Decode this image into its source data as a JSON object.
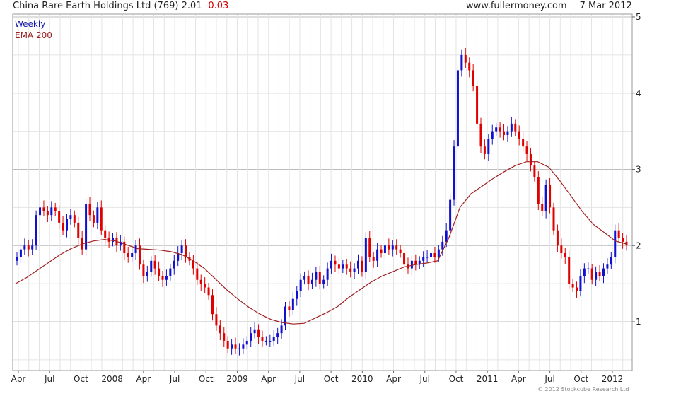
{
  "header": {
    "title": "China Rare Earth Holdings Ltd (769)",
    "price": "2.01",
    "change": "-0.03",
    "source": "www.fullermoney.com",
    "date": "7 Mar 2012"
  },
  "legend": {
    "weekly": "Weekly",
    "ema": "EMA 200"
  },
  "copyright": "© 2012 Stockcube Research Ltd",
  "colors": {
    "up": "#1010d0",
    "down": "#e00000",
    "ema": "#a02020",
    "grid": "#d8d8d8"
  },
  "chart_data": {
    "type": "line",
    "title": "China Rare Earth Holdings Ltd (769)",
    "xlabel": "",
    "ylabel": "",
    "ylim": [
      0.35,
      5.05
    ],
    "y_ticks": [
      1,
      2,
      3,
      4,
      5
    ],
    "x_tick_labels": [
      "Apr",
      "Jul",
      "Oct",
      "2008",
      "Apr",
      "Jul",
      "Oct",
      "2009",
      "Apr",
      "Jul",
      "Oct",
      "2010",
      "Apr",
      "Jul",
      "Oct",
      "2011",
      "Apr",
      "Jul",
      "Oct",
      "2012"
    ],
    "grid": true,
    "series": [
      {
        "name": "Weekly",
        "style": "candlestick",
        "values": [
          1.85,
          1.95,
          2.0,
          1.95,
          2.0,
          2.4,
          2.5,
          2.45,
          2.4,
          2.5,
          2.45,
          2.3,
          2.2,
          2.35,
          2.4,
          2.3,
          2.1,
          1.95,
          2.55,
          2.4,
          2.3,
          2.5,
          2.2,
          2.1,
          2.05,
          2.1,
          2.0,
          2.05,
          1.9,
          1.85,
          1.9,
          2.0,
          1.75,
          1.6,
          1.65,
          1.8,
          1.7,
          1.6,
          1.55,
          1.6,
          1.7,
          1.8,
          1.9,
          2.0,
          1.85,
          1.8,
          1.7,
          1.55,
          1.5,
          1.45,
          1.35,
          1.1,
          0.95,
          0.85,
          0.75,
          0.65,
          0.7,
          0.65,
          0.65,
          0.7,
          0.75,
          0.85,
          0.9,
          0.8,
          0.75,
          0.75,
          0.75,
          0.8,
          0.85,
          0.95,
          1.2,
          1.15,
          1.3,
          1.4,
          1.55,
          1.6,
          1.5,
          1.55,
          1.65,
          1.5,
          1.55,
          1.7,
          1.8,
          1.75,
          1.7,
          1.75,
          1.7,
          1.65,
          1.7,
          1.8,
          1.65,
          2.1,
          1.85,
          1.8,
          1.95,
          1.9,
          2.0,
          1.95,
          2.0,
          1.95,
          1.9,
          1.75,
          1.7,
          1.8,
          1.75,
          1.8,
          1.85,
          1.85,
          1.9,
          1.85,
          1.95,
          2.05,
          2.2,
          2.6,
          3.3,
          4.3,
          4.5,
          4.4,
          4.3,
          4.1,
          3.6,
          3.3,
          3.2,
          3.4,
          3.5,
          3.55,
          3.5,
          3.45,
          3.5,
          3.6,
          3.5,
          3.4,
          3.3,
          3.2,
          3.05,
          2.9,
          2.55,
          2.45,
          2.8,
          2.5,
          2.2,
          2.0,
          1.9,
          1.85,
          1.5,
          1.45,
          1.4,
          1.6,
          1.7,
          1.7,
          1.55,
          1.65,
          1.6,
          1.7,
          1.75,
          1.85,
          2.2,
          2.1,
          2.05,
          2.01
        ]
      },
      {
        "name": "EMA 200",
        "values": [
          1.5,
          1.58,
          1.68,
          1.78,
          1.88,
          1.96,
          2.02,
          2.06,
          2.08,
          2.06,
          2.01,
          1.96,
          1.95,
          1.94,
          1.92,
          1.88,
          1.8,
          1.7,
          1.56,
          1.42,
          1.3,
          1.19,
          1.1,
          1.03,
          0.99,
          0.97,
          0.98,
          1.05,
          1.12,
          1.2,
          1.32,
          1.42,
          1.52,
          1.6,
          1.66,
          1.72,
          1.75,
          1.77,
          1.8,
          2.1,
          2.5,
          2.68,
          2.78,
          2.88,
          2.97,
          3.05,
          3.1,
          3.1,
          3.03,
          2.85,
          2.65,
          2.45,
          2.28,
          2.17,
          2.06,
          2.02
        ]
      }
    ]
  }
}
